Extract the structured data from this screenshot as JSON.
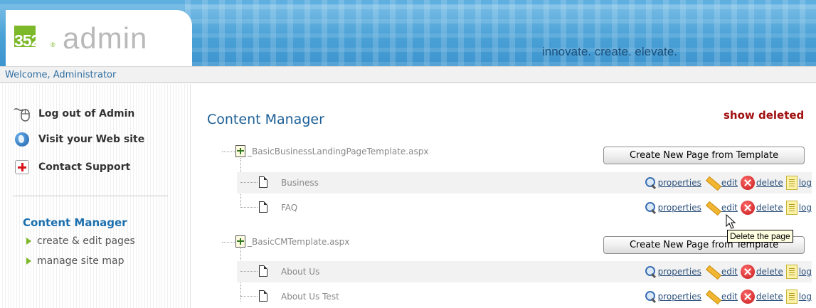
{
  "header": {
    "logo_number": "352",
    "logo_registered": "®",
    "logo_text": "admin",
    "tagline": "innovate. create. elevate."
  },
  "welcome": "Welcome, Administrator",
  "sidebar": {
    "links": [
      {
        "label": "Log out of Admin",
        "icon": "mouse-icon"
      },
      {
        "label": "Visit your Web site",
        "icon": "globe-icon"
      },
      {
        "label": "Contact Support",
        "icon": "plus-cross-icon"
      }
    ],
    "section_title": "Content Manager",
    "sub_items": [
      "create & edit pages",
      "manage site map"
    ]
  },
  "main": {
    "title": "Content Manager",
    "show_deleted": "show deleted",
    "templates": [
      {
        "name": "_BasicBusinessLandingPageTemplate.aspx",
        "button": "Create New Page from Template",
        "pages": [
          "Business",
          "FAQ"
        ]
      },
      {
        "name": "_BasicCMTemplate.aspx",
        "button": "Create New Page from Template",
        "pages": [
          "About Us",
          "About Us Test"
        ]
      }
    ],
    "actions": {
      "properties": "properties",
      "edit": "edit",
      "delete": "delete",
      "log": "log"
    }
  },
  "tooltip": "Delete the page",
  "colors": {
    "brand_green": "#7cb829",
    "header_blue": "#4aa1d6",
    "link_blue": "#1a6fae",
    "show_deleted_red": "#a01010"
  }
}
